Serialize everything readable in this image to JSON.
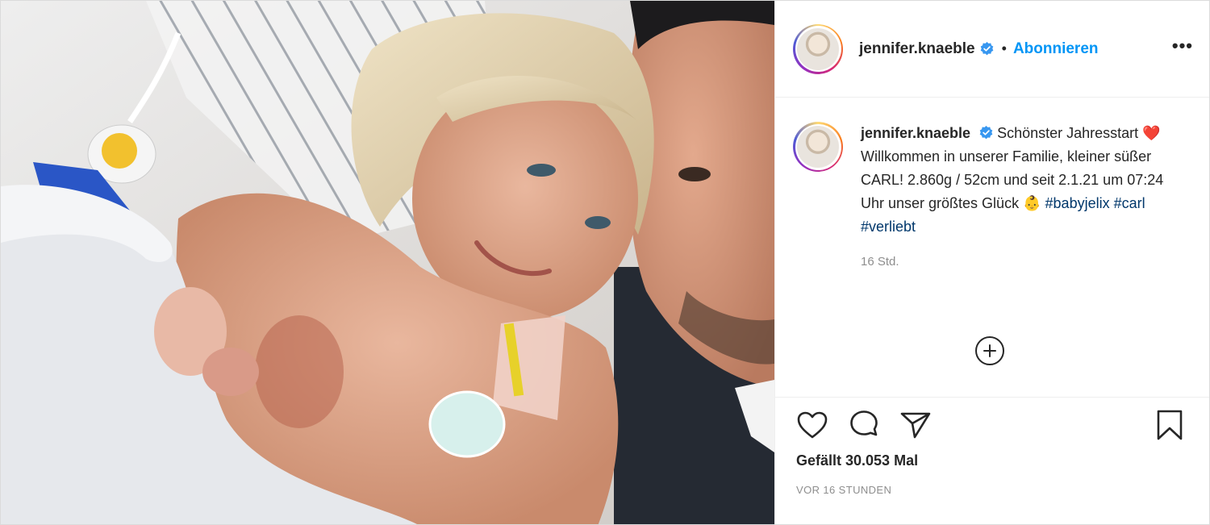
{
  "post": {
    "username": "jennifer.knaeble",
    "follow_label": "Abonnieren",
    "separator": "•",
    "more_label": "•••",
    "caption": {
      "username": "jennifer.knaeble",
      "part1": "Schönster Jahresstart",
      "heart_emoji": "❤️",
      "part2": "Willkommen in unserer Familie, kleiner süßer CARL! 2.860g / 52cm und seit 2.1.21 um 07:24 Uhr unser größtes Glück",
      "baby_emoji": "👶",
      "hashtags": [
        "#babyjelix",
        "#carl",
        "#verliebt"
      ]
    },
    "caption_time": "16 Std.",
    "likes_text": "Gefällt 30.053 Mal",
    "posted_ago": "VOR 16 STUNDEN"
  },
  "icons": {
    "verified": "verified-badge-icon",
    "like": "heart-outline-icon",
    "comment": "speech-bubble-icon",
    "share": "paper-plane-icon",
    "save": "bookmark-outline-icon",
    "load_more": "plus-circle-icon"
  },
  "colors": {
    "link_blue": "#0095f6",
    "hashtag_blue": "#00376b",
    "secondary_text": "#8e8e8e",
    "heart_red": "#e0245e"
  }
}
